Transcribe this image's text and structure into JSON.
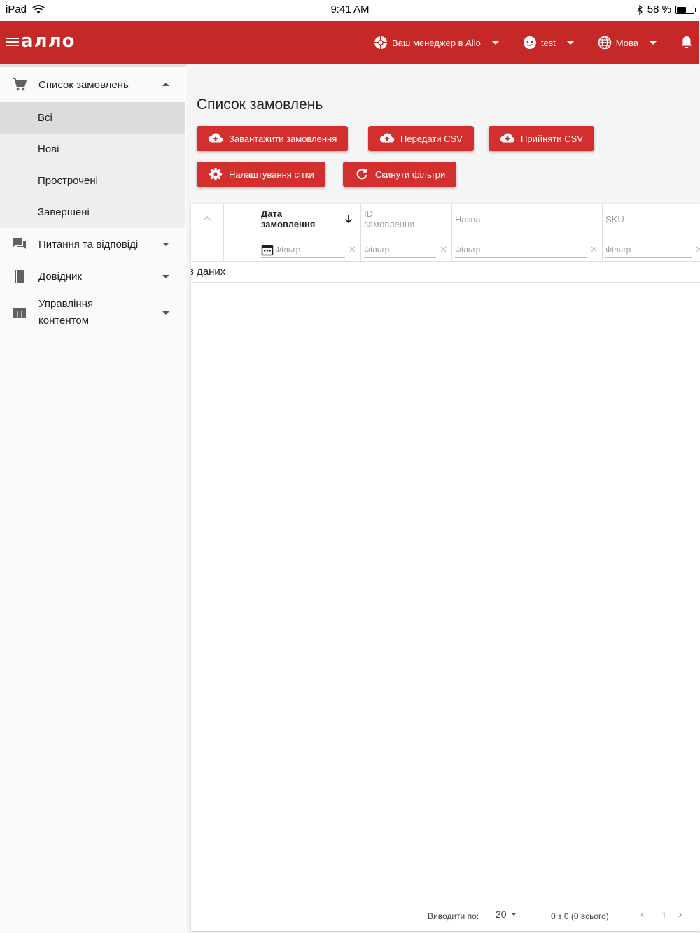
{
  "statusbar": {
    "device": "iPad",
    "time": "9:41 AM",
    "battery": "58 %",
    "battery_level": 0.58
  },
  "appbar": {
    "logo": "алло",
    "manager_label": "Ваш менеджер в Allo",
    "user_label": "test",
    "language_label": "Мова"
  },
  "sidebar": {
    "orders": "Список замовлень",
    "sub_items": [
      "Всі",
      "Нові",
      "Прострочені",
      "Завершені"
    ],
    "qa": "Питання та відповіді",
    "reference": "Довідник",
    "content_line1": "Управління",
    "content_line2": "контентом"
  },
  "main": {
    "title": "Список замовлень",
    "buttons": {
      "download": "Завантажити замовлення",
      "upload_csv": "Передати CSV",
      "accept_csv": "Прийняти CSV",
      "grid_settings": "Налаштування сітки",
      "reset_filters": "Скинути фільтри"
    }
  },
  "grid": {
    "columns": {
      "date_line1": "Дата",
      "date_line2": "замовлення",
      "id_line1": "ID",
      "id_line2": "замовлення",
      "name": "Назва",
      "sku": "SKU"
    },
    "filter_placeholder": "Фільтр",
    "clear_symbol": "✕",
    "no_data": "з даних",
    "pager": {
      "per_page_label": "Виводити по:",
      "per_page_value": "20",
      "summary": "0 з 0 (0 всього)",
      "page": "1"
    }
  },
  "colors": {
    "brand_red": "#c62828",
    "button_red": "#d32f2f"
  }
}
